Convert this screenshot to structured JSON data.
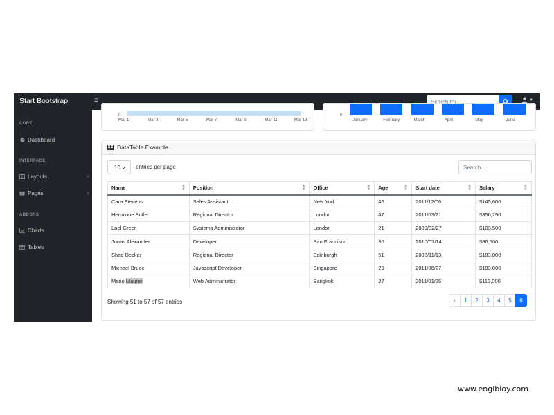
{
  "navbar": {
    "brand": "Start Bootstrap",
    "toggle_icon": "menu-icon",
    "search_placeholder": "Search for...",
    "search_icon": "search-icon",
    "user_icon": "user-icon"
  },
  "sidebar": {
    "sections": [
      {
        "heading": "CORE",
        "items": [
          {
            "label": "Dashboard",
            "icon": "dashboard-icon"
          }
        ]
      },
      {
        "heading": "INTERFACE",
        "items": [
          {
            "label": "Layouts",
            "icon": "columns-icon",
            "has_chevron": true
          },
          {
            "label": "Pages",
            "icon": "book-icon",
            "has_chevron": true
          }
        ]
      },
      {
        "heading": "ADDONS",
        "items": [
          {
            "label": "Charts",
            "icon": "chart-icon"
          },
          {
            "label": "Tables",
            "icon": "table-icon"
          }
        ]
      }
    ]
  },
  "area_chart": {
    "y_tick": "0",
    "x_ticks": [
      "Mar 1",
      "Mar 3",
      "Mar 5",
      "Mar 7",
      "Mar 9",
      "Mar 11",
      "Mar 13"
    ],
    "fill_color": "#c5dff5"
  },
  "bar_chart": {
    "y_tick": "0",
    "x_ticks": [
      "January",
      "February",
      "March",
      "April",
      "May",
      "June"
    ],
    "bar_color": "#0d6efd"
  },
  "datatable": {
    "title": "DataTable Example",
    "title_icon": "table-icon",
    "length_value": "10",
    "length_label": "entries per page",
    "search_placeholder": "Search...",
    "columns": [
      "Name",
      "Position",
      "Office",
      "Age",
      "Start date",
      "Salary"
    ],
    "rows": [
      [
        "Cara Stevens",
        "Sales Assistant",
        "New York",
        "46",
        "2011/12/06",
        "$145,600"
      ],
      [
        "Hermione Butler",
        "Regional Director",
        "London",
        "47",
        "2011/03/21",
        "$356,250"
      ],
      [
        "Lael Greer",
        "Systems Administrator",
        "London",
        "21",
        "2009/02/27",
        "$103,500"
      ],
      [
        "Jonas Alexander",
        "Developer",
        "San Francisco",
        "30",
        "2010/07/14",
        "$86,500"
      ],
      [
        "Shad Decker",
        "Regional Director",
        "Edinburgh",
        "51",
        "2008/11/13",
        "$183,000"
      ],
      [
        "Michael Bruce",
        "Javascript Developer",
        "Singapore",
        "29",
        "2011/06/27",
        "$183,000"
      ],
      [
        "Mario Maurer",
        "Web Administrator",
        "Bangkok",
        "27",
        "2011/01/25",
        "$112,000"
      ]
    ],
    "info": "Showing 51 to 57 of 57 entries",
    "pagination": {
      "prev": "‹",
      "pages": [
        "1",
        "2",
        "3",
        "4",
        "5",
        "6"
      ],
      "active": "6"
    }
  },
  "watermark": "www.engibloy.com",
  "colors": {
    "navbar_bg": "#212529",
    "accent": "#0d6efd"
  }
}
